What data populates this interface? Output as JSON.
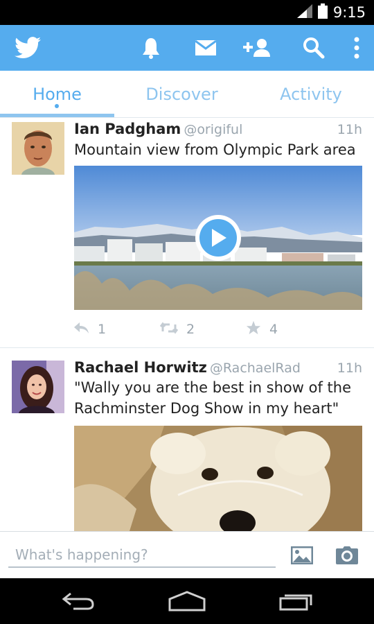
{
  "status_bar": {
    "time": "9:15",
    "icons": [
      "signal-icon",
      "battery-icon"
    ]
  },
  "action_bar": {
    "icons": [
      "twitter-logo-icon",
      "notifications-icon",
      "messages-icon",
      "add-user-icon",
      "search-icon",
      "overflow-menu-icon"
    ]
  },
  "tabs": [
    {
      "label": "Home",
      "active": true
    },
    {
      "label": "Discover",
      "active": false
    },
    {
      "label": "Activity",
      "active": false
    }
  ],
  "tweets": [
    {
      "name": "Ian Padgham",
      "handle": "@origiful",
      "time": "11h",
      "text": "Mountain view from Olympic Park area",
      "media": "video",
      "replies": "1",
      "retweets": "2",
      "favorites": "4"
    },
    {
      "name": "Rachael Horwitz",
      "handle": "@RachaelRad",
      "time": "11h",
      "text": "\"Wally you are the best in show of the Rachminster Dog Show in my heart\"",
      "media": "photo"
    }
  ],
  "composer": {
    "placeholder": "What's happening?",
    "icons": [
      "gallery-icon",
      "camera-icon"
    ]
  },
  "nav_bar": {
    "icons": [
      "back-icon",
      "home-icon",
      "recent-apps-icon"
    ]
  },
  "colors": {
    "brand": "#55acee",
    "tab_inactive": "#8ec5ef",
    "muted": "#9aa5ae"
  }
}
